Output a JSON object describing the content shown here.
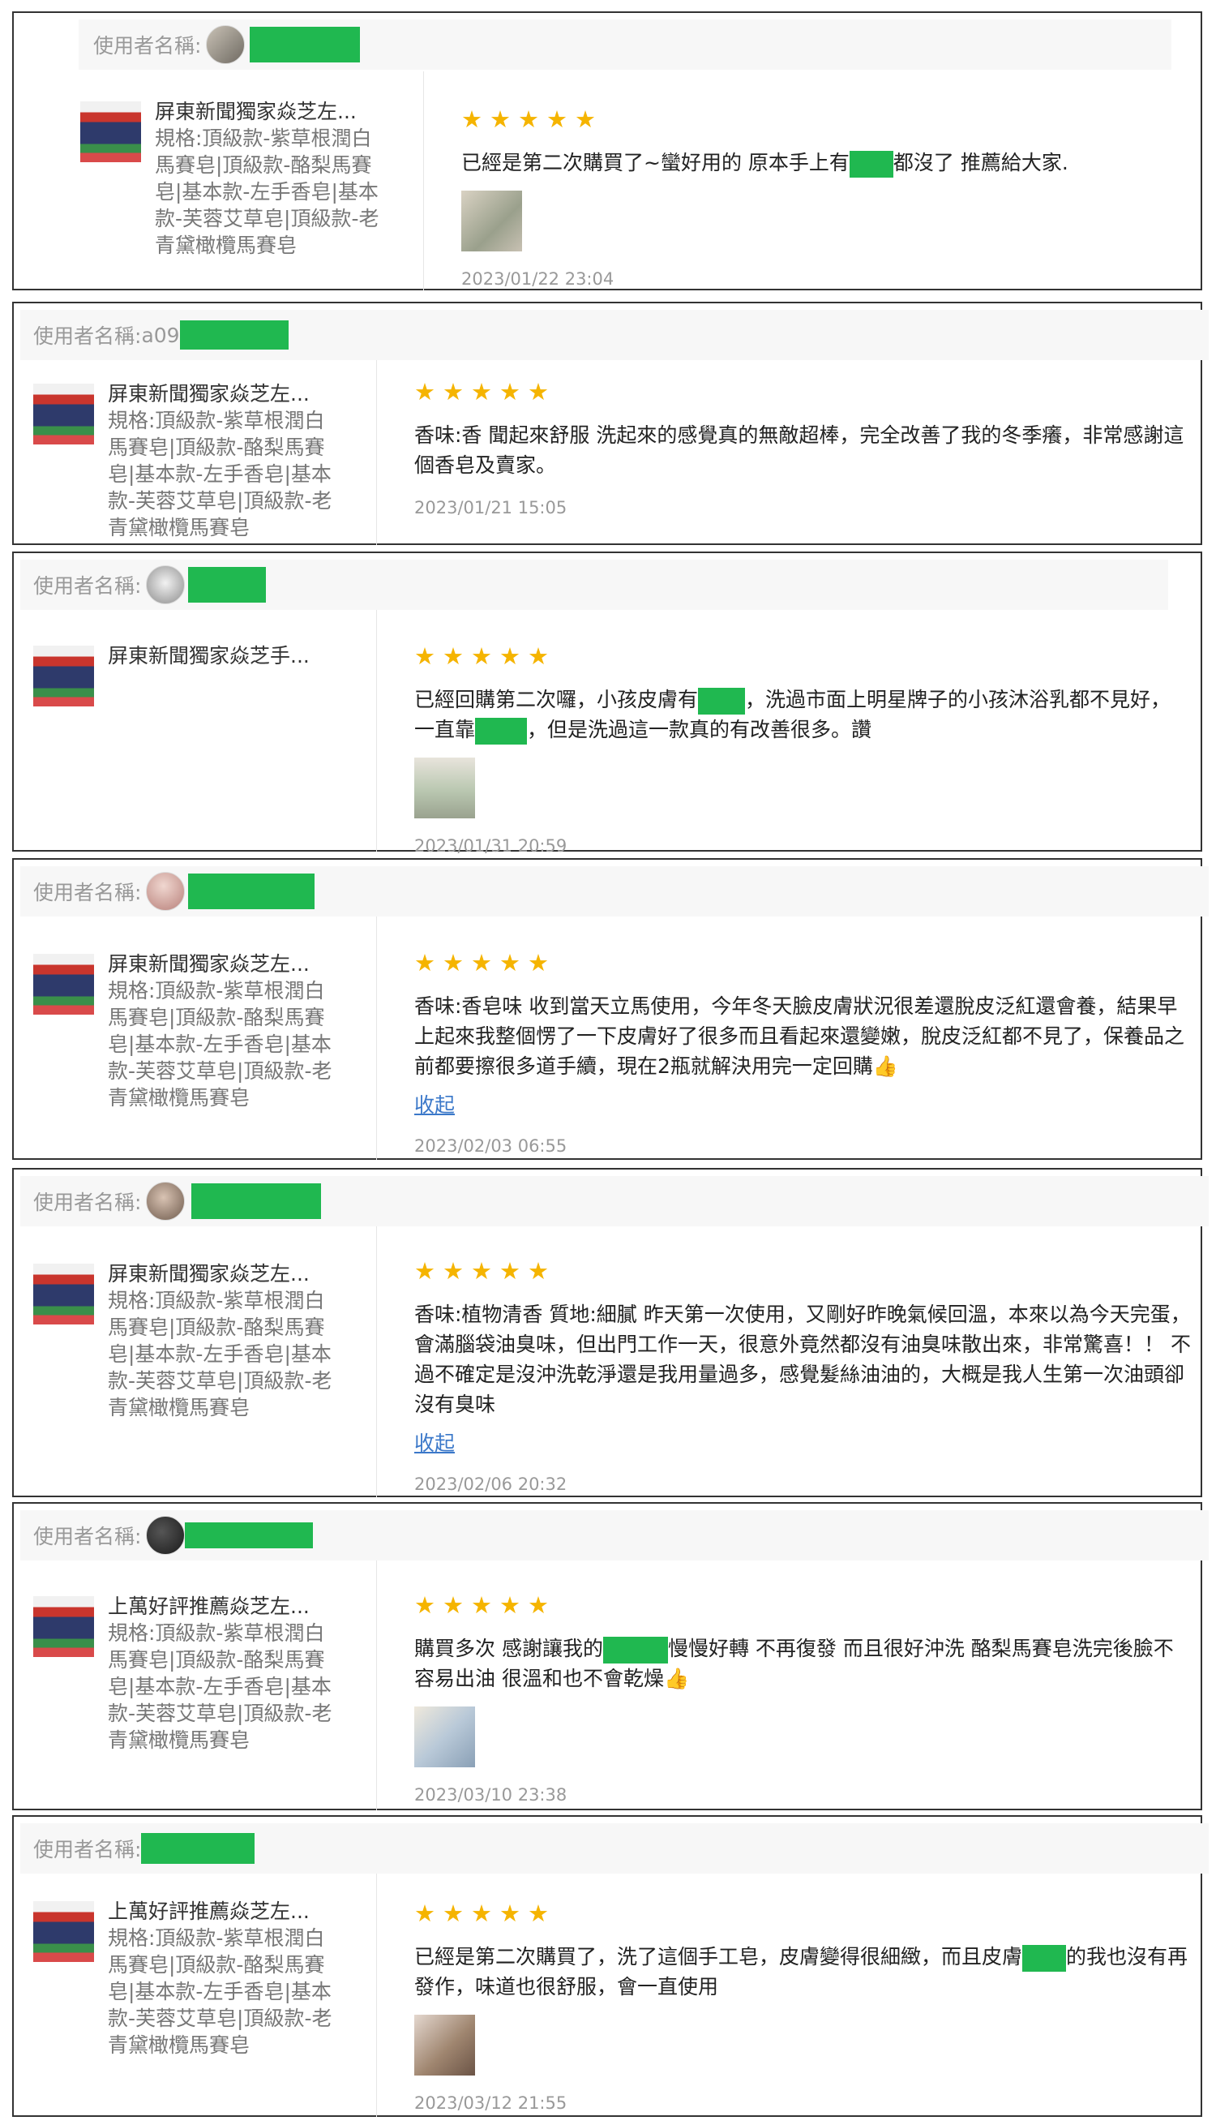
{
  "header_label": "使用者名稱:",
  "reviews": [
    {
      "user_prefix": "",
      "product_name": "屏東新聞獨家焱芝左...",
      "spec": "規格:頂級款-紫草根潤白馬賽皂|頂級款-酪梨馬賽皂|基本款-左手香皂|基本款-芙蓉艾草皂|頂級款-老青黛橄欖馬賽皂",
      "stars": "★★★★★",
      "comment_parts": [
        "已經是第二次購買了~蠻好用的 原本手上有",
        "都沒了 推薦給大家."
      ],
      "date": "2023/01/22 23:04",
      "collapse": ""
    },
    {
      "user_prefix": "a09",
      "product_name": "屏東新聞獨家焱芝左...",
      "spec": "規格:頂級款-紫草根潤白馬賽皂|頂級款-酪梨馬賽皂|基本款-左手香皂|基本款-芙蓉艾草皂|頂級款-老青黛橄欖馬賽皂",
      "stars": "★★★★★",
      "comment_parts": [
        "香味:香 聞起來舒服 洗起來的感覺真的無敵超棒，完全改善了我的冬季癢，非常感謝這個香皂及賣家。"
      ],
      "date": "2023/01/21 15:05",
      "collapse": ""
    },
    {
      "user_prefix": "",
      "product_name": "屏東新聞獨家焱芝手...",
      "spec": "",
      "stars": "★★★★★",
      "comment_parts": [
        "已經回購第二次囉，小孩皮膚有",
        "，洗過市面上明星牌子的小孩沐浴乳都不見好，一直靠",
        "，但是洗過這一款真的有改善很多。讚"
      ],
      "date": "2023/01/31 20:59",
      "collapse": ""
    },
    {
      "user_prefix": "",
      "product_name": "屏東新聞獨家焱芝左...",
      "spec": "規格:頂級款-紫草根潤白馬賽皂|頂級款-酪梨馬賽皂|基本款-左手香皂|基本款-芙蓉艾草皂|頂級款-老青黛橄欖馬賽皂",
      "stars": "★★★★★",
      "comment_parts": [
        "香味:香皂味 收到當天立馬使用，今年冬天臉皮膚狀況很差還脫皮泛紅還會養，結果早上起來我整個愣了一下皮膚好了很多而且看起來還變嫩，脫皮泛紅都不見了，保養品之前都要擦很多道手續，現在2瓶就解決用完一定回購👍"
      ],
      "date": "2023/02/03 06:55",
      "collapse": "收起"
    },
    {
      "user_prefix": "",
      "product_name": "屏東新聞獨家焱芝左...",
      "spec": "規格:頂級款-紫草根潤白馬賽皂|頂級款-酪梨馬賽皂|基本款-左手香皂|基本款-芙蓉艾草皂|頂級款-老青黛橄欖馬賽皂",
      "stars": "★★★★★",
      "comment_parts": [
        "香味:植物清香 質地:細膩 昨天第一次使用，又剛好昨晚氣候回溫，本來以為今天完蛋，會滿腦袋油臭味，但出門工作一天，很意外竟然都沒有油臭味散出來，非常驚喜！！ 不過不確定是沒沖洗乾淨還是我用量過多，感覺髮絲油油的，大概是我人生第一次油頭卻沒有臭味"
      ],
      "date": "2023/02/06 20:32",
      "collapse": "收起"
    },
    {
      "user_prefix": "",
      "product_name": "上萬好評推薦焱芝左...",
      "spec": "規格:頂級款-紫草根潤白馬賽皂|頂級款-酪梨馬賽皂|基本款-左手香皂|基本款-芙蓉艾草皂|頂級款-老青黛橄欖馬賽皂",
      "stars": "★★★★★",
      "comment_parts": [
        "購買多次 感謝讓我的",
        "慢慢好轉 不再復發 而且很好沖洗 酪梨馬賽皂洗完後臉不容易出油 很溫和也不會乾燥👍"
      ],
      "date": "2023/03/10 23:38",
      "collapse": ""
    },
    {
      "user_prefix": "",
      "product_name": "上萬好評推薦焱芝左...",
      "spec": "規格:頂級款-紫草根潤白馬賽皂|頂級款-酪梨馬賽皂|基本款-左手香皂|基本款-芙蓉艾草皂|頂級款-老青黛橄欖馬賽皂",
      "stars": "★★★★★",
      "comment_parts": [
        "已經是第二次購買了，洗了這個手工皂，皮膚變得很細緻，而且皮膚",
        "的我也沒有再發作，味道也很舒服，會一直使用"
      ],
      "date": "2023/03/12 21:55",
      "collapse": ""
    }
  ]
}
